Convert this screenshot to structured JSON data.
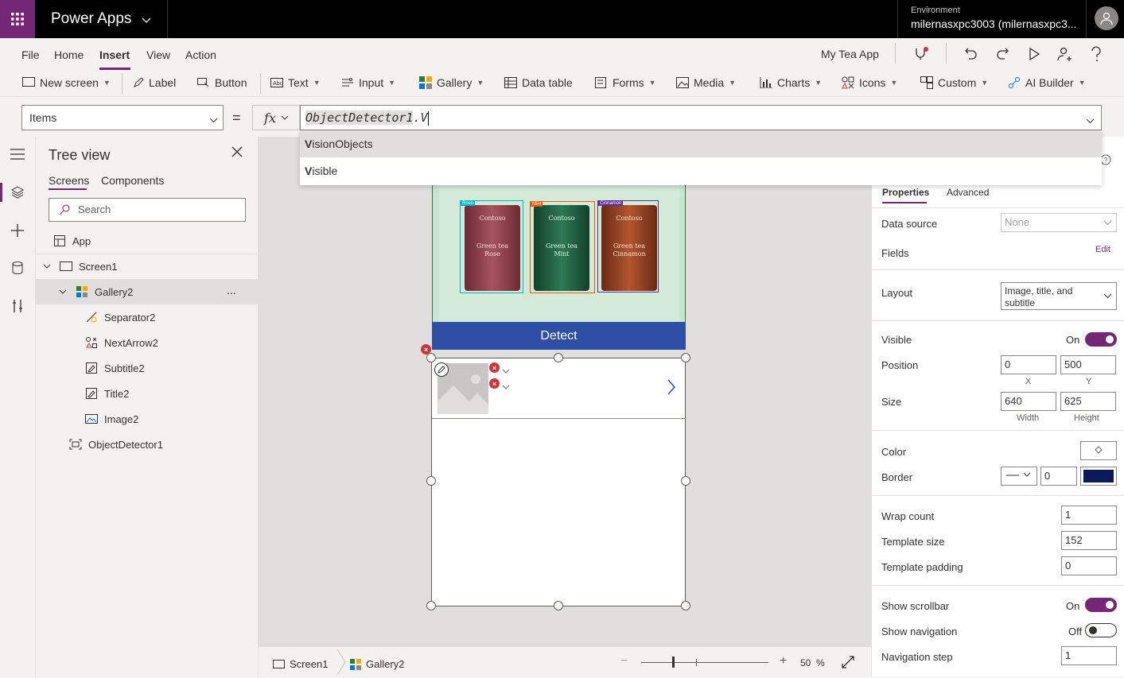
{
  "topbar": {
    "app_name": "Power Apps",
    "environment_label": "Environment",
    "environment_value": "milernasxpc3003 (milernasxpc3..."
  },
  "menu": {
    "items": [
      "File",
      "Home",
      "Insert",
      "View",
      "Action"
    ],
    "active": "Insert",
    "app_title": "My Tea App"
  },
  "ribbon": {
    "new_screen": "New screen",
    "label": "Label",
    "button": "Button",
    "text": "Text",
    "input": "Input",
    "gallery": "Gallery",
    "data_table": "Data table",
    "forms": "Forms",
    "media": "Media",
    "charts": "Charts",
    "icons": "Icons",
    "custom": "Custom",
    "ai_builder": "AI Builder"
  },
  "formula": {
    "property": "Items",
    "equals": "=",
    "fx": "fx",
    "token": "ObjectDetector1",
    "typed": ".V",
    "suggestions": [
      {
        "bold": "V",
        "rest": "isionObjects"
      },
      {
        "bold": "V",
        "rest": "isible"
      }
    ]
  },
  "tree": {
    "title": "Tree view",
    "tabs": [
      "Screens",
      "Components"
    ],
    "search_placeholder": "Search",
    "items": {
      "app": "App",
      "screen1": "Screen1",
      "gallery2": "Gallery2",
      "more": "...",
      "separator2": "Separator2",
      "nextarrow2": "NextArrow2",
      "subtitle2": "Subtitle2",
      "title2": "Title2",
      "image2": "Image2",
      "objectdetector1": "ObjectDetector1"
    }
  },
  "canvas": {
    "detect_button": "Detect",
    "tag_labels": [
      "Rose",
      "Mint",
      "Cinnamon"
    ],
    "can_brand": "Contoso",
    "cans": [
      {
        "line1": "Green tea",
        "line2": "Rose",
        "color": "#8a3a45"
      },
      {
        "line1": "Green tea",
        "line2": "Mint",
        "color": "#1f5a3a"
      },
      {
        "line1": "Green tea",
        "line2": "Cinnamon",
        "color": "#8a3a1f"
      }
    ],
    "tag_colors": [
      "#00b7c3",
      "#e8590c",
      "#5c2e91"
    ]
  },
  "status": {
    "breadcrumb_screen": "Screen1",
    "breadcrumb_gallery": "Gallery2",
    "zoom_value": "50",
    "zoom_unit": "%",
    "zoom_minus": "−",
    "zoom_plus": "+"
  },
  "properties": {
    "tabs": [
      "Properties",
      "Advanced"
    ],
    "data_source_label": "Data source",
    "data_source_value": "None",
    "fields_label": "Fields",
    "fields_edit": "Edit",
    "layout_label": "Layout",
    "layout_value": "Image, title, and subtitle",
    "visible_label": "Visible",
    "visible_state": "On",
    "position_label": "Position",
    "position_x": "0",
    "position_y": "500",
    "x_label": "X",
    "y_label": "Y",
    "size_label": "Size",
    "width": "640",
    "height": "625",
    "width_label": "Width",
    "height_label": "Height",
    "color_label": "Color",
    "border_label": "Border",
    "border_width": "0",
    "border_color": "#0b1a5c",
    "wrap_count_label": "Wrap count",
    "wrap_count": "1",
    "template_size_label": "Template size",
    "template_size": "152",
    "template_padding_label": "Template padding",
    "template_padding": "0",
    "show_scrollbar_label": "Show scrollbar",
    "show_scrollbar_state": "On",
    "show_navigation_label": "Show navigation",
    "show_navigation_state": "Off",
    "navigation_step_label": "Navigation step",
    "navigation_step": "1"
  },
  "colors": {
    "brand": "#742774",
    "detect_button": "#2f4fa6"
  }
}
